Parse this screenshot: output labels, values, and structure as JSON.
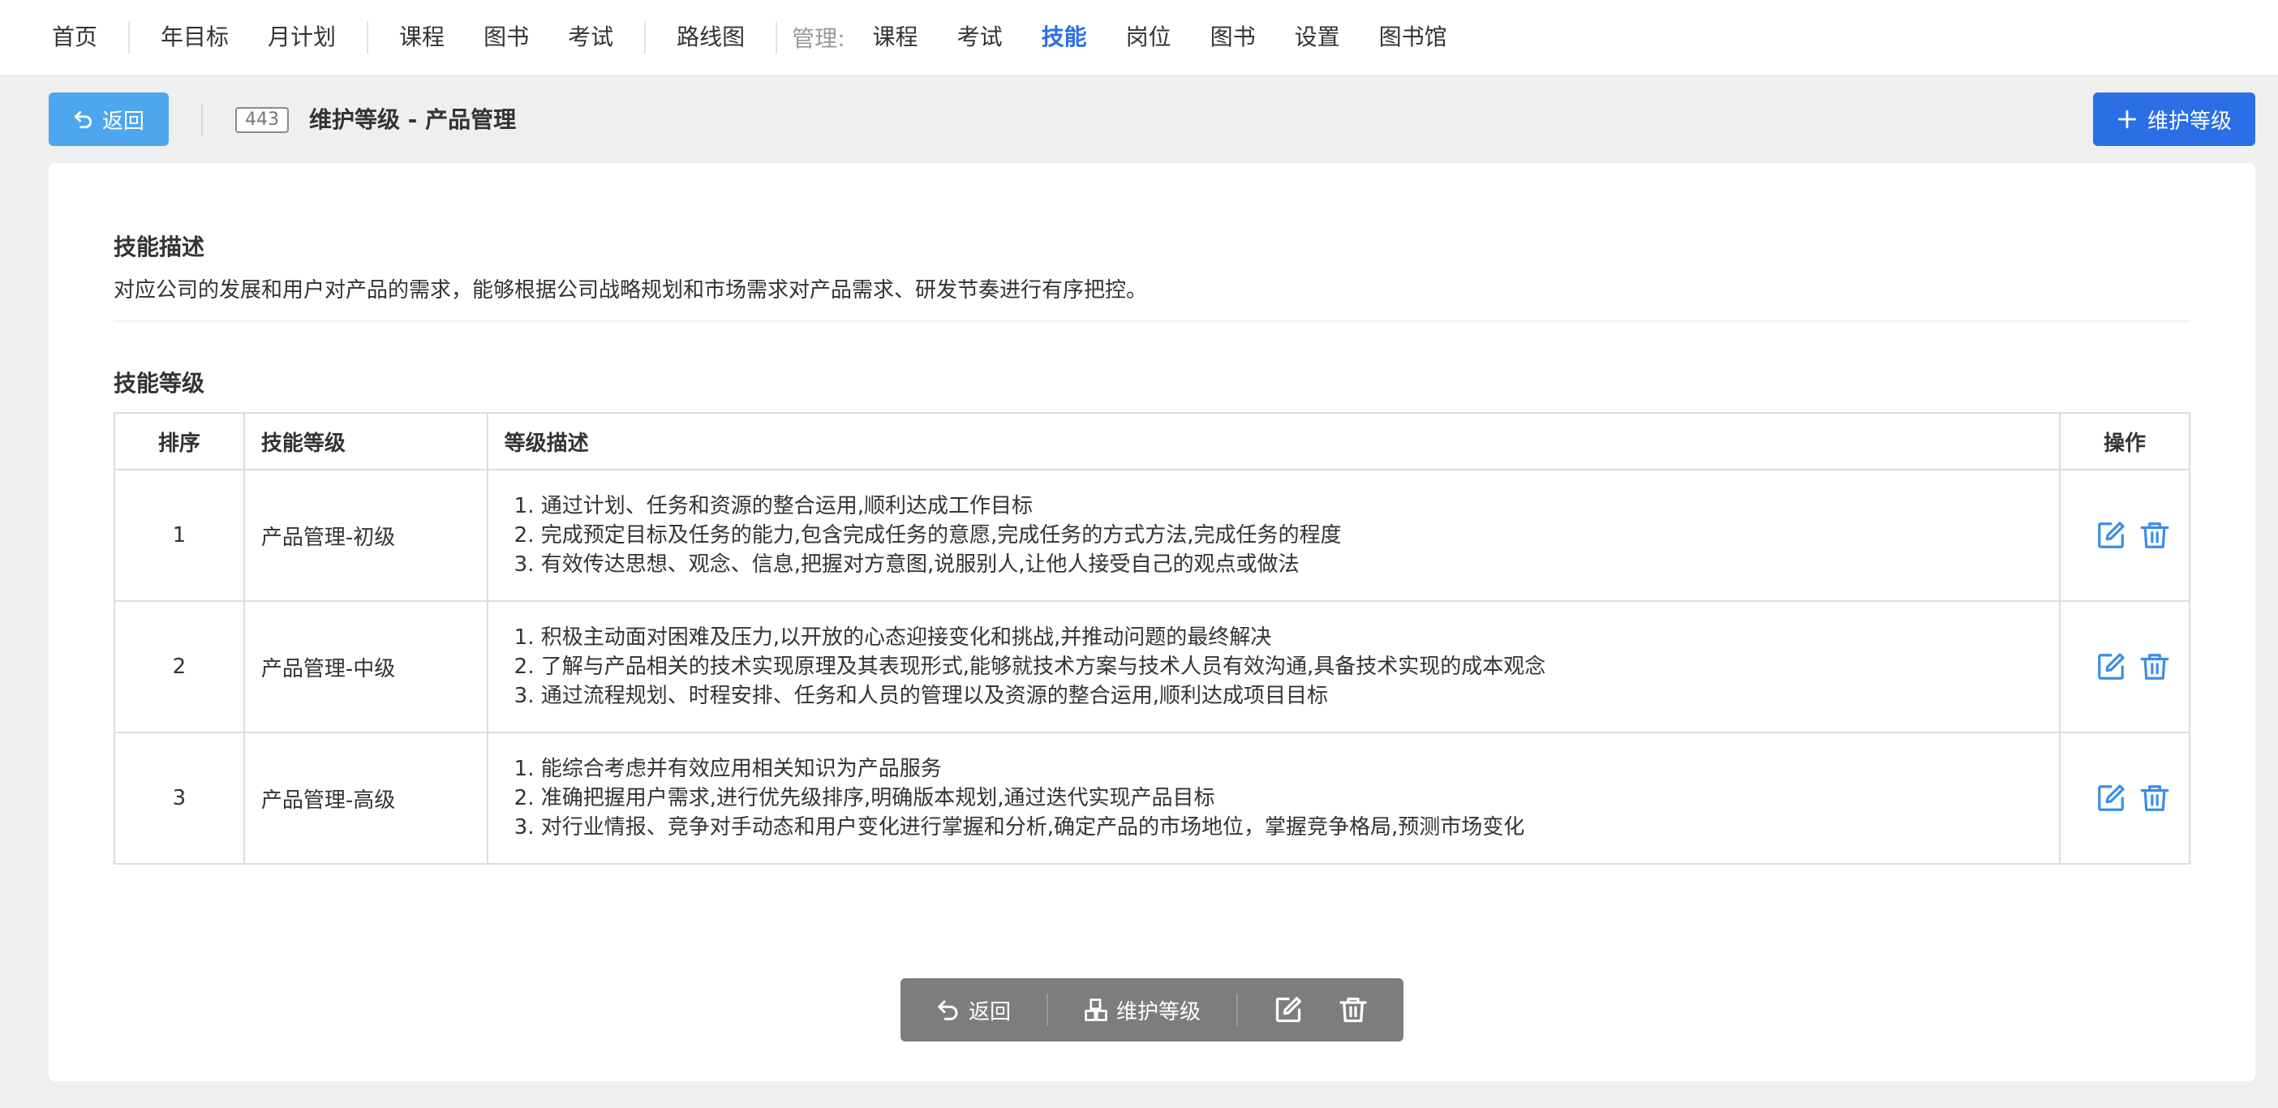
{
  "nav": {
    "items": [
      {
        "label": "首页"
      },
      {
        "label": "年目标"
      },
      {
        "label": "月计划"
      },
      {
        "label": "课程"
      },
      {
        "label": "图书"
      },
      {
        "label": "考试"
      },
      {
        "label": "路线图"
      }
    ],
    "manage_label": "管理:",
    "manage_items": [
      {
        "label": "课程"
      },
      {
        "label": "考试"
      },
      {
        "label": "技能",
        "active": true
      },
      {
        "label": "岗位"
      },
      {
        "label": "图书"
      },
      {
        "label": "设置"
      },
      {
        "label": "图书馆"
      }
    ]
  },
  "header": {
    "back_label": "返回",
    "id_badge": "443",
    "title": "维护等级 - 产品管理",
    "add_label": "维护等级"
  },
  "skill": {
    "desc_title": "技能描述",
    "desc_text": "对应公司的发展和用户对产品的需求，能够根据公司战略规划和市场需求对产品需求、研发节奏进行有序把控。",
    "levels_title": "技能等级"
  },
  "table": {
    "headers": {
      "order": "排序",
      "level": "技能等级",
      "desc": "等级描述",
      "ops": "操作"
    },
    "rows": [
      {
        "order": "1",
        "level": "产品管理-初级",
        "desc": [
          "1. 通过计划、任务和资源的整合运用,顺利达成工作目标",
          "2. 完成预定目标及任务的能力,包含完成任务的意愿,完成任务的方式方法,完成任务的程度",
          "3. 有效传达思想、观念、信息,把握对方意图,说服别人,让他人接受自己的观点或做法"
        ]
      },
      {
        "order": "2",
        "level": "产品管理-中级",
        "desc": [
          "1. 积极主动面对困难及压力,以开放的心态迎接变化和挑战,并推动问题的最终解决",
          "2. 了解与产品相关的技术实现原理及其表现形式,能够就技术方案与技术人员有效沟通,具备技术实现的成本观念",
          "3. 通过流程规划、时程安排、任务和人员的管理以及资源的整合运用,顺利达成项目目标"
        ]
      },
      {
        "order": "3",
        "level": "产品管理-高级",
        "desc": [
          "1. 能综合考虑并有效应用相关知识为产品服务",
          "2. 准确把握用户需求,进行优先级排序,明确版本规划,通过迭代实现产品目标",
          "3. 对行业情报、竞争对手动态和用户变化进行掌握和分析,确定产品的市场地位，掌握竞争格局,预测市场变化"
        ]
      }
    ]
  },
  "floatbar": {
    "back_label": "返回",
    "levels_label": "维护等级"
  },
  "colors": {
    "accent": "#2b6fe6",
    "back_button": "#4ea6ee",
    "icon_blue": "#3a8ee6",
    "toolbar_bg": "#7d7d7d"
  }
}
